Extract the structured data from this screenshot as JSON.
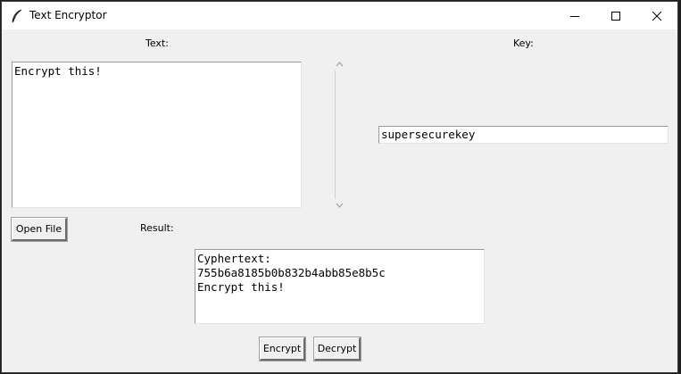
{
  "window": {
    "title": "Text Encryptor"
  },
  "text_section": {
    "label": "Text:",
    "content": "Encrypt this!"
  },
  "key_section": {
    "label": "Key:",
    "value": "supersecurekey"
  },
  "open_file_button": {
    "label": "Open File"
  },
  "result_section": {
    "label": "Result:",
    "content": "Cyphertext:\n755b6a8185b0b832b4abb85e8b5c\nEncrypt this!"
  },
  "actions": {
    "encrypt_label": "Encrypt",
    "decrypt_label": "Decrypt"
  },
  "icons": {
    "app": "feather-icon",
    "minimize": "minimize-icon",
    "maximize": "maximize-icon",
    "close": "close-icon",
    "scroll_up": "chevron-up-icon",
    "scroll_down": "chevron-down-icon"
  }
}
